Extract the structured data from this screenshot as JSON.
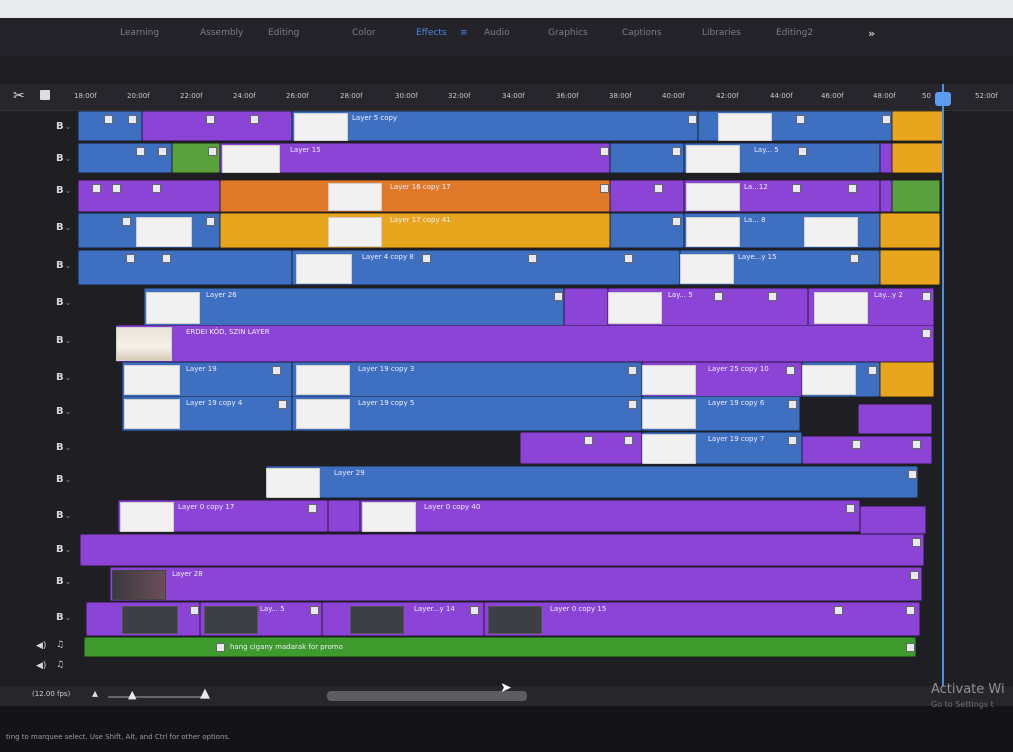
{
  "workspace_tabs": [
    "Learning",
    "Assembly",
    "Editing",
    "Color",
    "Effects",
    "Audio",
    "Graphics",
    "Captions",
    "Libraries",
    "Editing2"
  ],
  "active_workspace": "Effects",
  "more_label": "»",
  "ruler_labels": [
    "18:00f",
    "20:00f",
    "22:00f",
    "24:00f",
    "26:00f",
    "28:00f",
    "30:00f",
    "32:00f",
    "34:00f",
    "36:00f",
    "38:00f",
    "40:00f",
    "42:00f",
    "44:00f",
    "46:00f",
    "48:00f",
    "50",
    "52:00f"
  ],
  "clip_labels": {
    "t1": "Layer 5 copy",
    "t2": "Layer 15",
    "t2b": "Lay... 5",
    "t3": "Layer 16 copy 17",
    "t3b": "La...12",
    "t4": "Layer 17 copy 41",
    "t4b": "La... 8",
    "t5": "Layer 4 copy 8",
    "t5b": "Laye...y 15",
    "t6": "Layer 26",
    "t6b": "Lay... 5",
    "t6c": "Lay...y 2",
    "t7": "ERDEI KÓD, SZIN LAYER",
    "t8": "Layer 19",
    "t8b": "Layer 19 copy 3",
    "t8c": "Layer 25 copy 10",
    "t9": "Layer 19 copy 4",
    "t9b": "Layer 19 copy 5",
    "t9c": "Layer 19 copy 6",
    "t10": "Layer 19 copy 7",
    "t11": "Layer 29",
    "t12": "Layer 0 copy 17",
    "t12b": "Layer 0 copy 40",
    "t14": "Layer 28",
    "t15a": "Lay... 5",
    "t15b": "Layer...y 14",
    "t15c": "Layer 0 copy 15",
    "audio": "hang cigany madarak for promo"
  },
  "fps_label": "(12.00 fps)",
  "status_text": "ting to marquee select. Use Shift, Alt, and Ctrl for other options.",
  "activate_title": "Activate Wi",
  "activate_sub": "Go to Settings t",
  "colors": {
    "blue": "#3f6fc0",
    "purple": "#8c44d6",
    "orange": "#e07a2a",
    "gold": "#e8a51e",
    "green": "#5aa03c",
    "audio_green": "#3f9a2e",
    "playhead": "#4c8fe0"
  },
  "icons": [
    "scissors-icon",
    "snap-icon",
    "film-icon",
    "speaker-icon",
    "music-note-icon",
    "zoom-out-icon",
    "zoom-in-icon",
    "cursor-icon"
  ]
}
